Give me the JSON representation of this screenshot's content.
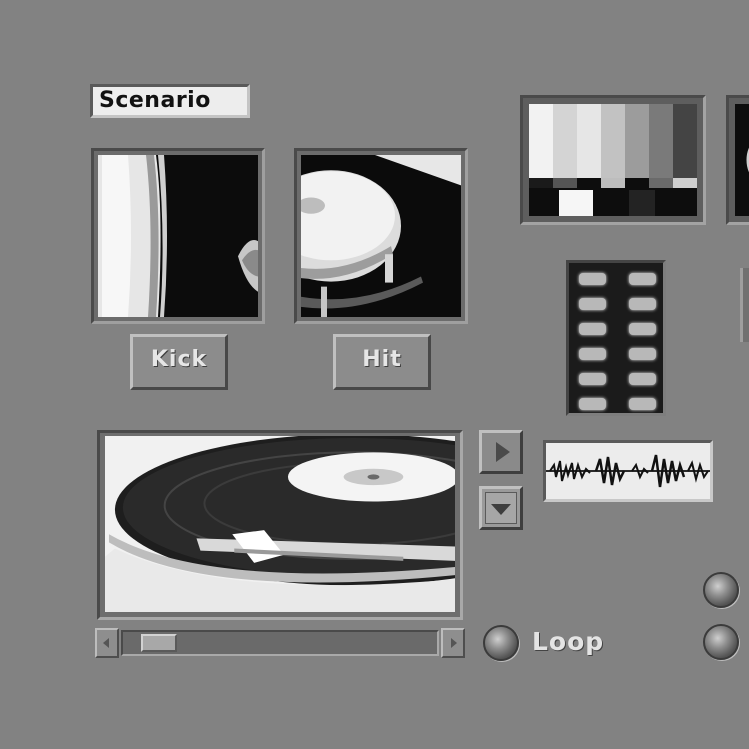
{
  "window": {
    "scenario_title": "Scenario"
  },
  "thumbnails": [
    {
      "button_label": "Kick",
      "icon": "turntable-closeup-image"
    },
    {
      "button_label": "Hit",
      "icon": "turntable-platter-image"
    }
  ],
  "preview": {
    "icon": "vinyl-record-image"
  },
  "transport": {
    "play_icon": "play-triangle-icon",
    "down_icon": "down-triangle-icon"
  },
  "waveform": {
    "icon": "audio-waveform-icon"
  },
  "loop": {
    "label": "Loop"
  },
  "scrollbar": {
    "position": 0.05
  },
  "meter": {
    "rows": 6,
    "columns": 2
  },
  "colors": {
    "background": "#828282",
    "field": "#ededed",
    "meter_bg": "#1b1b1b"
  }
}
